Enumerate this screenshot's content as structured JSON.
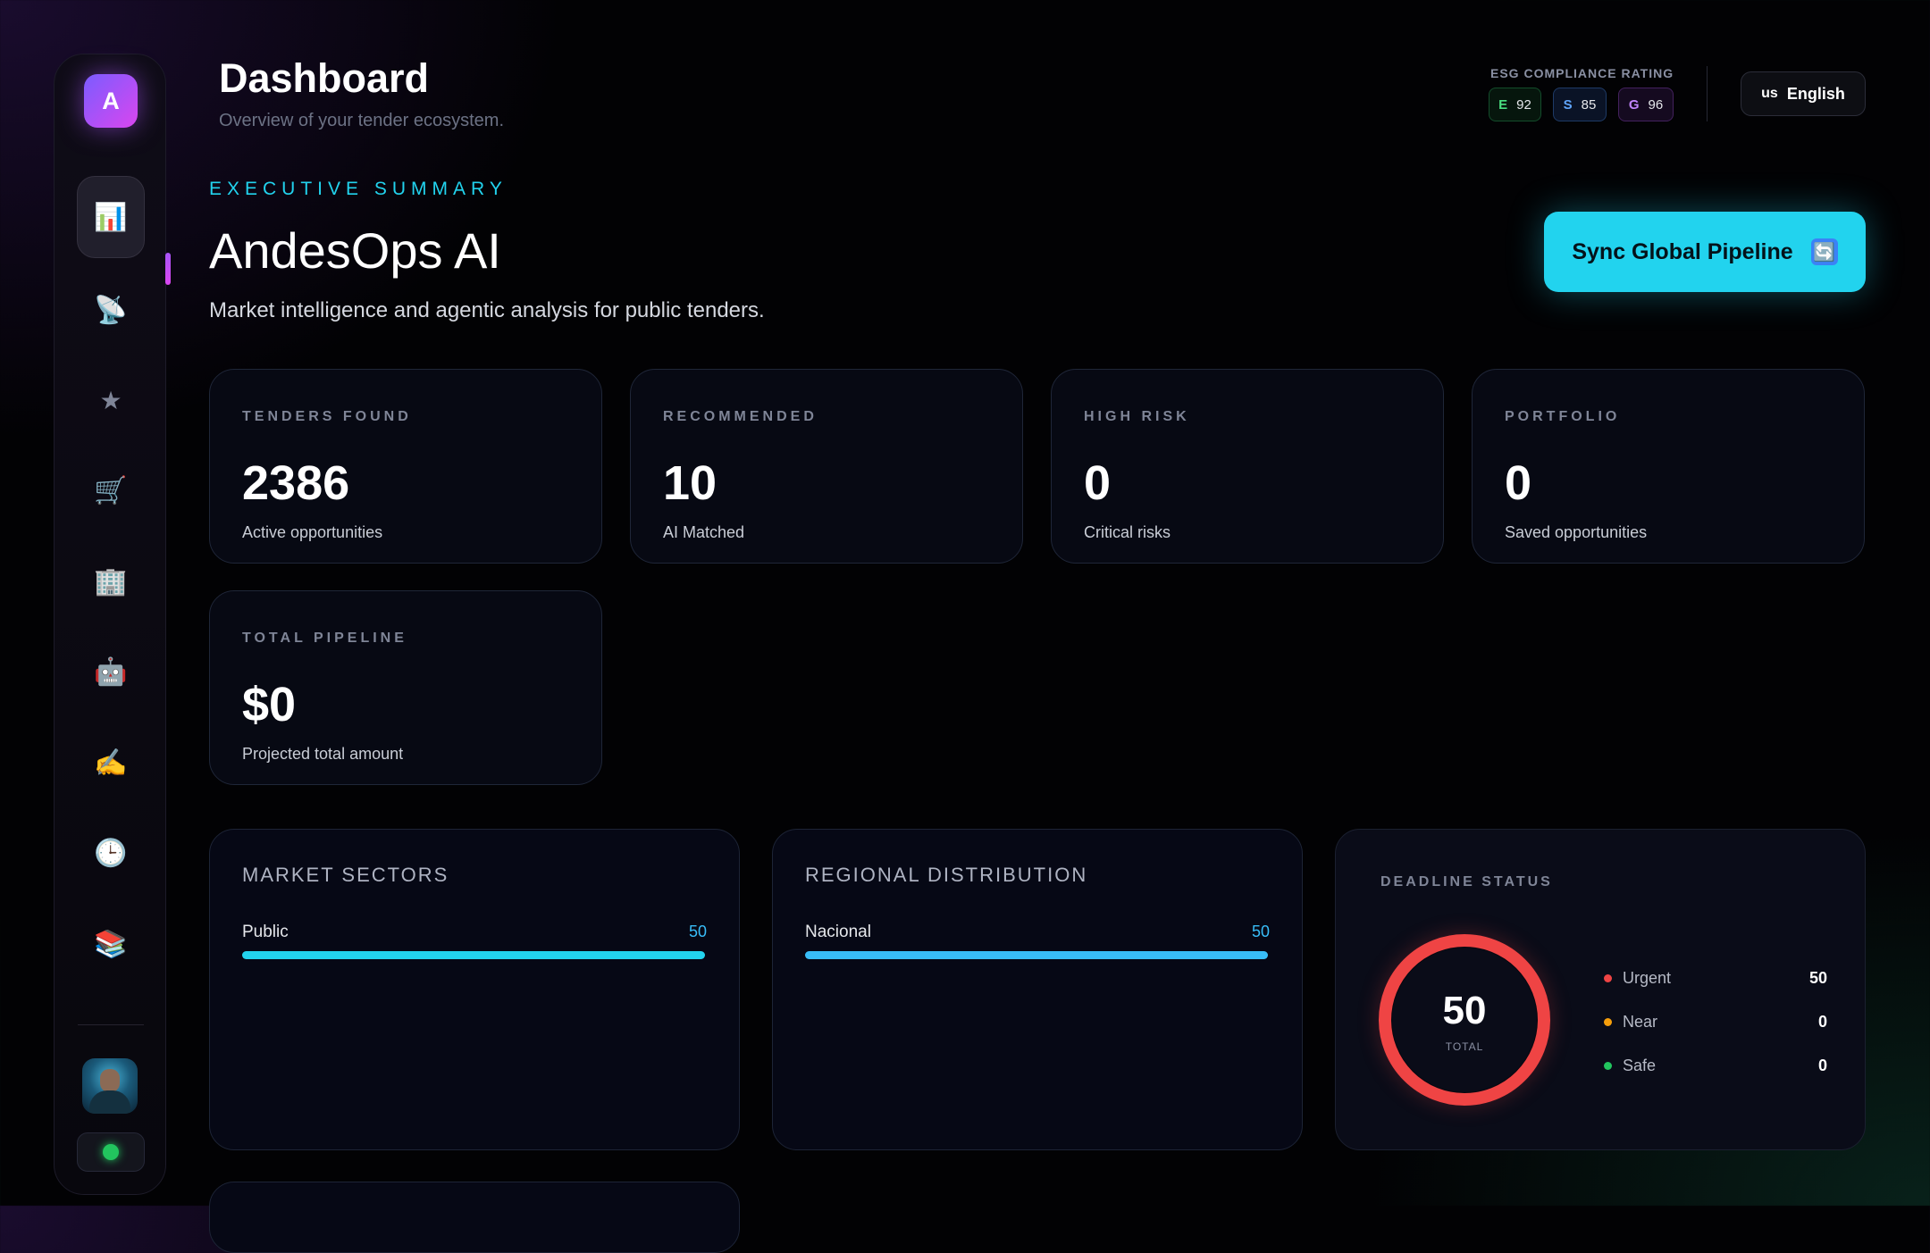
{
  "sidebar": {
    "logo_letter": "A",
    "nav_items": [
      {
        "name": "dashboard",
        "icon": "📊"
      },
      {
        "name": "satellite",
        "icon": "📡"
      },
      {
        "name": "favorites",
        "icon": "★"
      },
      {
        "name": "cart",
        "icon": "🛒"
      },
      {
        "name": "buildings",
        "icon": "🏢"
      },
      {
        "name": "ai-agent",
        "icon": "🤖"
      },
      {
        "name": "sign",
        "icon": "✍️"
      },
      {
        "name": "history",
        "icon": "🕒"
      },
      {
        "name": "reports",
        "icon": "📚"
      }
    ],
    "status_color": "#22c55e"
  },
  "header": {
    "title": "Dashboard",
    "subtitle": "Overview of your tender ecosystem.",
    "esg": {
      "label": "ESG COMPLIANCE RATING",
      "items": [
        {
          "letter": "E",
          "score": "92",
          "color": "#4ade80"
        },
        {
          "letter": "S",
          "score": "85",
          "color": "#60a5fa"
        },
        {
          "letter": "G",
          "score": "96",
          "color": "#c084fc"
        }
      ]
    },
    "language": {
      "flag": "us",
      "label": "English"
    }
  },
  "hero": {
    "eyebrow": "EXECUTIVE SUMMARY",
    "title": "AndesOps AI",
    "description": "Market intelligence and agentic analysis for public tenders.",
    "sync_button": "Sync Global Pipeline",
    "sync_icon": "🔄"
  },
  "stats": [
    {
      "label": "TENDERS FOUND",
      "value": "2386",
      "sub": "Active opportunities"
    },
    {
      "label": "RECOMMENDED",
      "value": "10",
      "sub": "AI Matched"
    },
    {
      "label": "HIGH RISK",
      "value": "0",
      "sub": "Critical risks"
    },
    {
      "label": "PORTFOLIO",
      "value": "0",
      "sub": "Saved opportunities"
    },
    {
      "label": "TOTAL PIPELINE",
      "value": "$0",
      "sub": "Projected total amount"
    }
  ],
  "market_sectors": {
    "title": "MARKET SECTORS",
    "rows": [
      {
        "label": "Public",
        "value": "50",
        "fill_fraction": 1.0
      }
    ]
  },
  "regional_distribution": {
    "title": "REGIONAL DISTRIBUTION",
    "rows": [
      {
        "label": "Nacional",
        "value": "50",
        "fill_fraction": 1.0
      }
    ]
  },
  "deadline_status": {
    "title": "DEADLINE STATUS",
    "total": "50",
    "total_caption": "TOTAL",
    "legend": [
      {
        "label": "Urgent",
        "value": "50",
        "color": "#ef4444"
      },
      {
        "label": "Near",
        "value": "0",
        "color": "#f59e0b"
      },
      {
        "label": "Safe",
        "value": "0",
        "color": "#22c55e"
      }
    ]
  }
}
